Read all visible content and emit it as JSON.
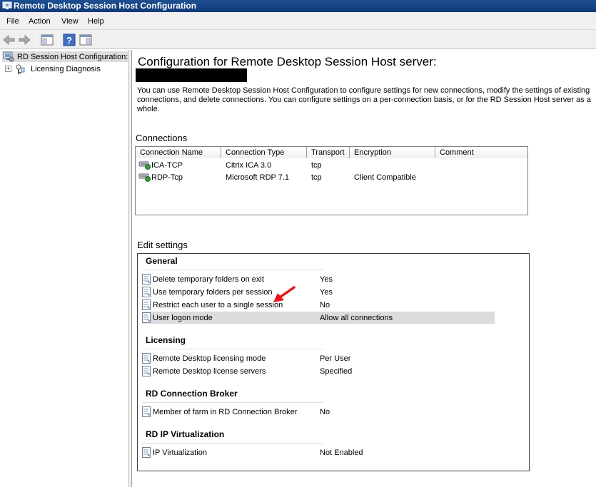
{
  "window": {
    "title": "Remote Desktop Session Host Configuration"
  },
  "menu": {
    "items": [
      "File",
      "Action",
      "View",
      "Help"
    ]
  },
  "toolbar": {
    "buttons": [
      "back-icon",
      "forward-icon",
      "show-hide-console-tree-icon",
      "help-icon",
      "show-action-pane-icon"
    ]
  },
  "tree": {
    "root_label": "RD Session Host Configuration:",
    "children": [
      {
        "label": "Licensing Diagnosis",
        "expander": "+"
      }
    ]
  },
  "main": {
    "title": "Configuration for Remote Desktop Session Host server:",
    "intro": "You can use Remote Desktop Session Host Configuration to configure settings for new connections, modify the settings of existing connections, and delete connections. You can configure settings on a per-connection basis, or for the RD Session Host server as a whole."
  },
  "connections": {
    "heading": "Connections",
    "columns": [
      "Connection Name",
      "Connection Type",
      "Transport",
      "Encryption",
      "Comment"
    ],
    "rows": [
      {
        "name": "ICA-TCP",
        "type": "Citrix ICA 3.0",
        "transport": "tcp",
        "encryption": "",
        "comment": ""
      },
      {
        "name": "RDP-Tcp",
        "type": "Microsoft RDP 7.1",
        "transport": "tcp",
        "encryption": "Client Compatible",
        "comment": ""
      }
    ]
  },
  "edit_settings": {
    "heading": "Edit settings",
    "groups": [
      {
        "title": "General",
        "settings": [
          {
            "name": "Delete temporary folders on exit",
            "value": "Yes"
          },
          {
            "name": "Use temporary folders per session",
            "value": "Yes"
          },
          {
            "name": "Restrict each user to a single session",
            "value": "No"
          },
          {
            "name": "User logon mode",
            "value": "Allow all connections",
            "selected": true
          }
        ]
      },
      {
        "title": "Licensing",
        "settings": [
          {
            "name": "Remote Desktop licensing mode",
            "value": "Per User"
          },
          {
            "name": "Remote Desktop license servers",
            "value": "Specified"
          }
        ]
      },
      {
        "title": "RD Connection Broker",
        "settings": [
          {
            "name": "Member of farm in RD Connection Broker",
            "value": "No"
          }
        ]
      },
      {
        "title": "RD IP Virtualization",
        "settings": [
          {
            "name": "IP Virtualization",
            "value": "Not Enabled"
          }
        ]
      }
    ]
  },
  "colors": {
    "titlebar": "#1d4f91",
    "selection": "#dcdcdc",
    "annotation_arrow": "#e8141a"
  }
}
